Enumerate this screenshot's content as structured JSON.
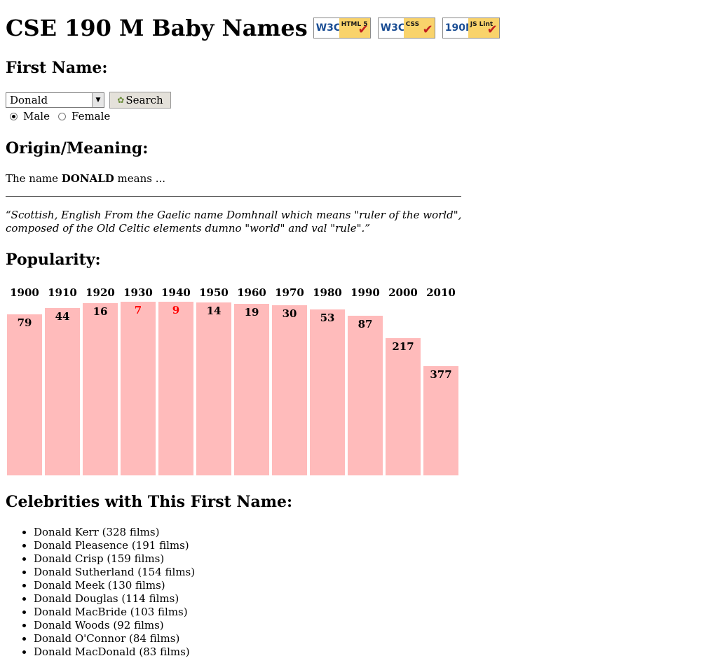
{
  "title": "CSE 190 M Baby Names",
  "badges": [
    {
      "name": "html5-badge",
      "left": "W3C",
      "right": "HTML 5"
    },
    {
      "name": "css-badge",
      "left": "W3C",
      "right": "CSS"
    },
    {
      "name": "jslint-badge",
      "left": "190M",
      "right": "JS Lint"
    }
  ],
  "form": {
    "heading": "First Name:",
    "selected_name": "Donald",
    "search_label": "Search",
    "gender": {
      "male_label": "Male",
      "female_label": "Female",
      "selected": "male"
    }
  },
  "origin": {
    "heading": "Origin/Meaning:",
    "prefix": "The name ",
    "name_upper": "DONALD",
    "suffix": " means ...",
    "quote": "“Scottish, English From the Gaelic name Domhnall which means \"ruler of the world\", composed of the Old Celtic elements dumno \"world\" and val \"rule\".”"
  },
  "popularity": {
    "heading": "Popularity:"
  },
  "chart_data": {
    "type": "bar",
    "categories": [
      "1900",
      "1910",
      "1920",
      "1930",
      "1940",
      "1950",
      "1960",
      "1970",
      "1980",
      "1990",
      "2000",
      "2010"
    ],
    "values": [
      79,
      44,
      16,
      7,
      9,
      14,
      19,
      30,
      53,
      87,
      217,
      377
    ],
    "value_meaning": "rank (lower is more popular; bar height = (1000 - rank) / 4 px)",
    "highlight_color": "#ff0000",
    "bar_color": "#ffbbbb"
  },
  "celebrities": {
    "heading": "Celebrities with This First Name:",
    "items": [
      "Donald Kerr (328 films)",
      "Donald Pleasence (191 films)",
      "Donald Crisp (159 films)",
      "Donald Sutherland (154 films)",
      "Donald Meek (130 films)",
      "Donald Douglas (114 films)",
      "Donald MacBride (103 films)",
      "Donald Woods (92 films)",
      "Donald O'Connor (84 films)",
      "Donald MacDonald (83 films)"
    ]
  }
}
